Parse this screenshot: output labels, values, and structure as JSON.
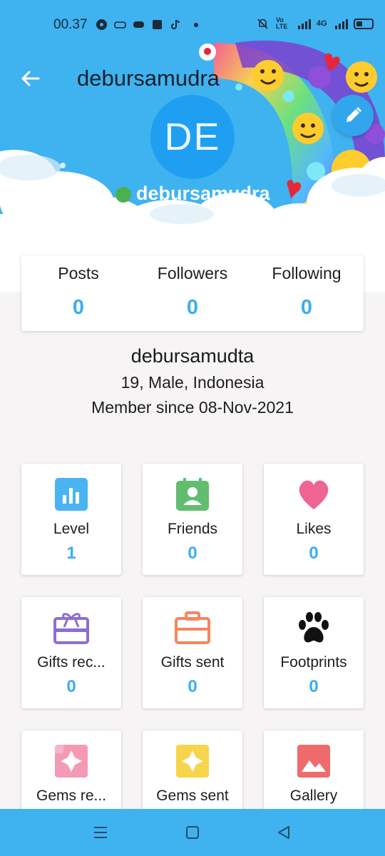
{
  "status_bar": {
    "time": "00.37",
    "network_label": "Vo LTE",
    "network_type": "4G"
  },
  "header": {
    "title": "debursamudra",
    "avatar_initials": "DE",
    "username": "debursamudra",
    "online": true
  },
  "stats": [
    {
      "label": "Posts",
      "value": "0"
    },
    {
      "label": "Followers",
      "value": "0"
    },
    {
      "label": "Following",
      "value": "0"
    }
  ],
  "profile": {
    "display_name": "debursamudta",
    "details": "19, Male, Indonesia",
    "member_since": "Member since 08-Nov-2021"
  },
  "tiles": [
    {
      "label": "Level",
      "value": "1",
      "icon": "bar-chart-icon",
      "color": "#4ab3f2"
    },
    {
      "label": "Friends",
      "value": "0",
      "icon": "contact-icon",
      "color": "#62bd70"
    },
    {
      "label": "Likes",
      "value": "0",
      "icon": "heart-icon",
      "color": "#ef6492"
    },
    {
      "label": "Gifts rec...",
      "value": "0",
      "icon": "gift-icon",
      "color": "#8c6ed3"
    },
    {
      "label": "Gifts sent",
      "value": "0",
      "icon": "briefcase-icon",
      "color": "#f4865f"
    },
    {
      "label": "Footprints",
      "value": "0",
      "icon": "paw-icon",
      "color": "#111111"
    },
    {
      "label": "Gems re...",
      "value": "",
      "icon": "gem-pink-icon",
      "color": "#f59ab5"
    },
    {
      "label": "Gems sent",
      "value": "",
      "icon": "gem-yellow-icon",
      "color": "#f7d54a"
    },
    {
      "label": "Gallery",
      "value": "",
      "icon": "image-icon",
      "color": "#ef6b6b"
    }
  ],
  "colors": {
    "accent": "#3fb2f0",
    "value_blue": "#3aaef0",
    "online_green": "#4cb050"
  }
}
